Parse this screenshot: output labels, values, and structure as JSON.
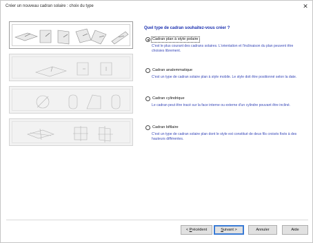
{
  "window": {
    "title": "Créer un nouveau cadran solaire : choix du type",
    "close_glyph": "✕"
  },
  "question": "Quel type de cadran souhaitez-vous créer ?",
  "options": [
    {
      "label": "Cadran plan à style polaire",
      "checked": true,
      "description": "C'est le plus courant des cadrans solaires. L'orientation et l'inclinaison du plan peuvent être choisies librement."
    },
    {
      "label": "Cadran analemmatique",
      "checked": false,
      "description": "C'est un type de cadran solaire plan à style mobile. Le style doit être positionné selon la date."
    },
    {
      "label": "Cadran cylindrique",
      "checked": false,
      "description": "Le cadran peut être tracé sur la face interne ou externe d'un cylindre pouvant être incliné."
    },
    {
      "label": "Cadran bifilaire",
      "checked": false,
      "description": "C'est un type de cadran solaire plan dont le style est constitué de deux fils croisés fixés à des hauteurs différentes."
    }
  ],
  "thumbnails": [
    {
      "icon": "polar-style-sundial-icons"
    },
    {
      "icon": "analemmatic-sundial-icons"
    },
    {
      "icon": "cylindrical-sundial-icons"
    },
    {
      "icon": "bifilar-sundial-icons"
    }
  ],
  "buttons": {
    "previous": {
      "mnemonic": "P",
      "rest": "récédent",
      "prefix": "< "
    },
    "next": {
      "mnemonic": "S",
      "rest": "uivant",
      "suffix": " >"
    },
    "cancel": "Annuler",
    "help": "Aide"
  }
}
